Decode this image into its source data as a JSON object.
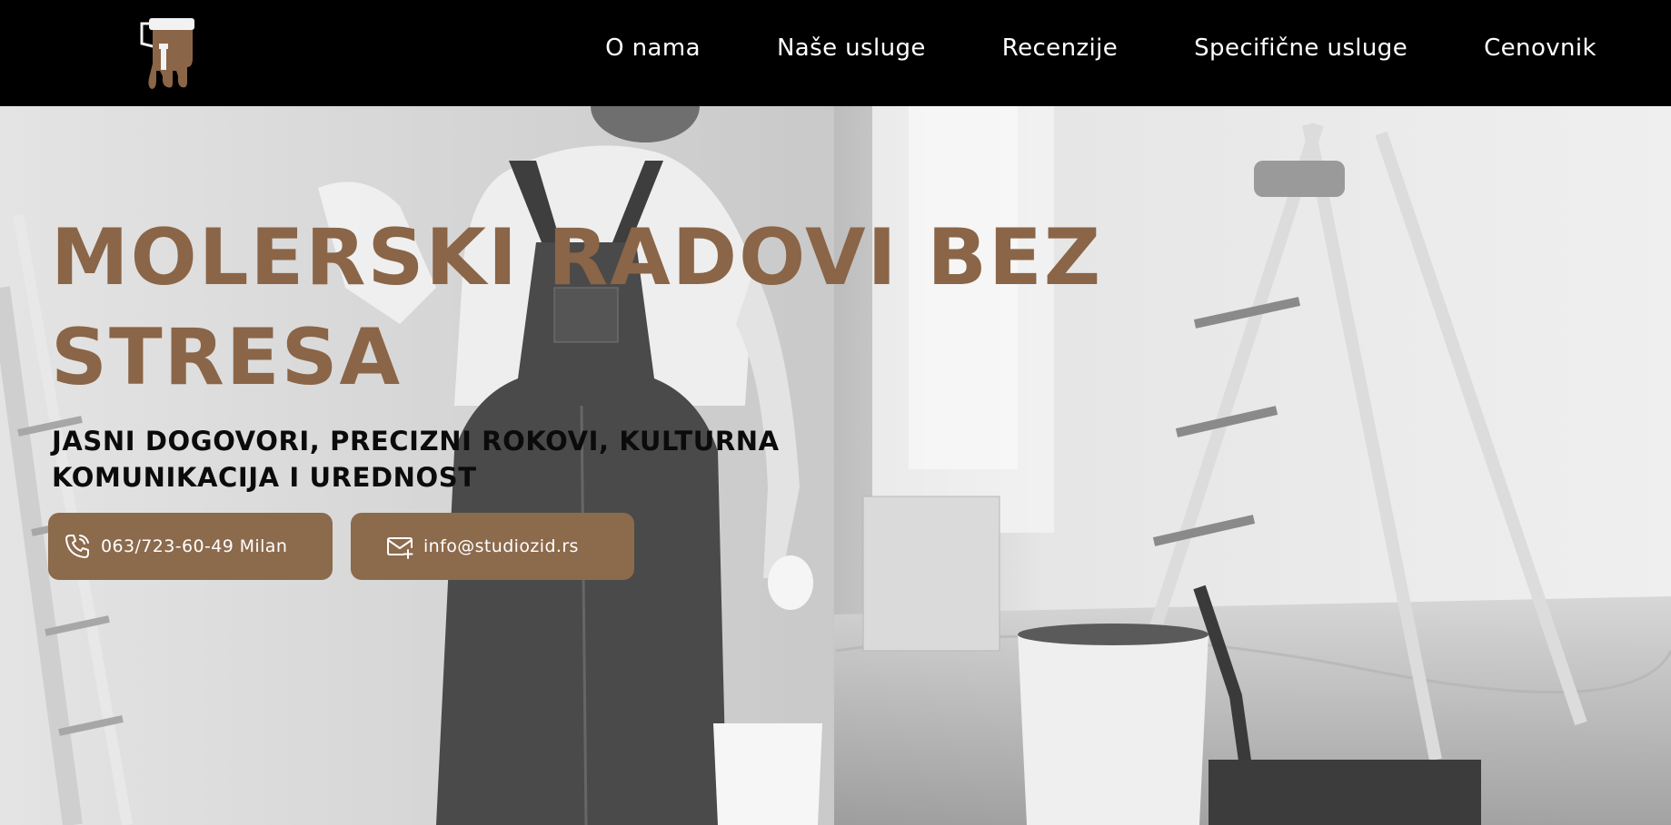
{
  "brand": {
    "logo_icon": "paint-roller-icon",
    "accent": "#8a6547"
  },
  "nav": {
    "items": [
      {
        "label": "O nama"
      },
      {
        "label": "Naše usluge"
      },
      {
        "label": "Recenzije"
      },
      {
        "label": "Specifične usluge"
      },
      {
        "label": "Cenovnik"
      }
    ]
  },
  "hero": {
    "headline_line1": "MOLERSKI RADOVI BEZ",
    "headline_line2": "STRESA",
    "subline_line1": "JASNI DOGOVORI, PRECIZNI ROKOVI, KULTURNA",
    "subline_line2": "KOMUNIKACIJA I UREDNOST",
    "phone_button": {
      "label": "063/723-60-49 Milan",
      "icon": "phone-icon"
    },
    "email_button": {
      "label": "info@studiozid.rs",
      "icon": "mail-icon"
    }
  }
}
